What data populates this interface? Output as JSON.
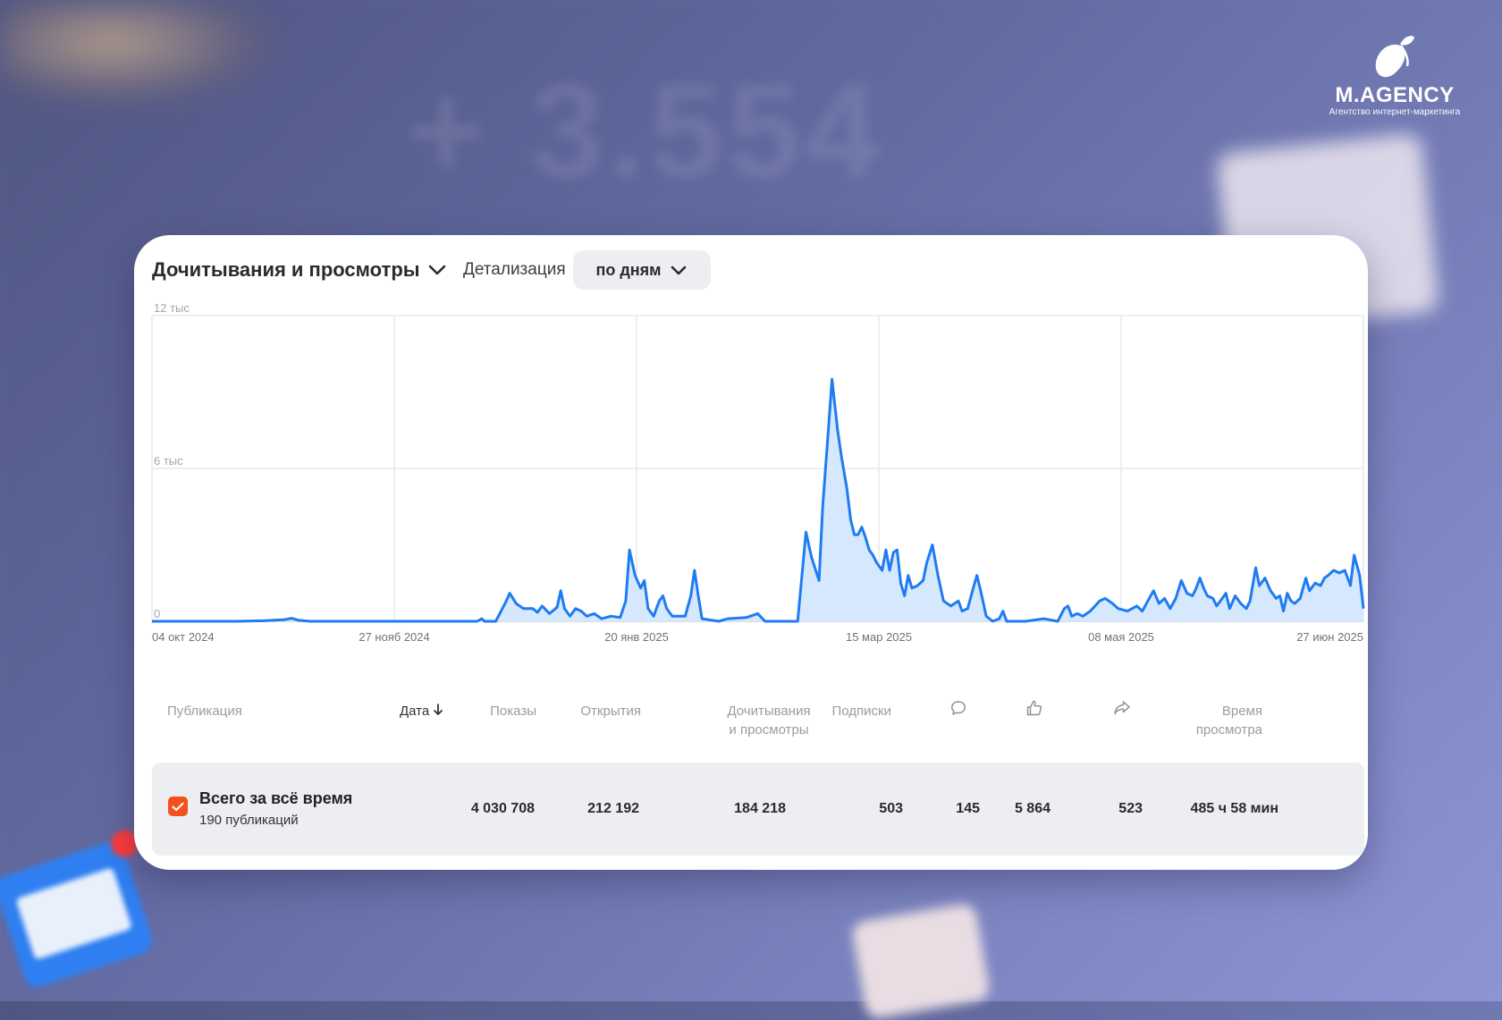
{
  "background": {
    "big_number": "+ 3.554"
  },
  "logo": {
    "name": "M.AGENCY",
    "tagline": "Агентство интернет-маркетинга"
  },
  "header": {
    "metric_select_label": "Дочитывания и просмотры",
    "detail_label": "Детализация",
    "period_select_label": "по дням"
  },
  "chart_data": {
    "type": "area",
    "y_tick_labels": [
      "12 тыс",
      "6 тыс",
      "0"
    ],
    "x_tick_labels": [
      "04 окт 2024",
      "27 нояб 2024",
      "20 янв 2025",
      "15 мар 2025",
      "08 мая 2025",
      "27 июн 2025"
    ],
    "ylim": [
      0,
      12000
    ],
    "grid": true,
    "color": "#1f7cf0",
    "fill_color": "#d6e8fd",
    "series": [
      {
        "points": [
          [
            0,
            0
          ],
          [
            30,
            0
          ],
          [
            60,
            0
          ],
          [
            90,
            0
          ],
          [
            120,
            20
          ],
          [
            142,
            60
          ],
          [
            150,
            120
          ],
          [
            158,
            40
          ],
          [
            170,
            0
          ],
          [
            200,
            0
          ],
          [
            230,
            0
          ],
          [
            260,
            0
          ],
          [
            290,
            0
          ],
          [
            320,
            0
          ],
          [
            350,
            0
          ],
          [
            355,
            100
          ],
          [
            358,
            0
          ],
          [
            370,
            0
          ],
          [
            380,
            700
          ],
          [
            385,
            1100
          ],
          [
            392,
            700
          ],
          [
            400,
            500
          ],
          [
            410,
            500
          ],
          [
            415,
            350
          ],
          [
            420,
            600
          ],
          [
            428,
            300
          ],
          [
            436,
            550
          ],
          [
            440,
            1200
          ],
          [
            444,
            500
          ],
          [
            450,
            200
          ],
          [
            456,
            500
          ],
          [
            462,
            400
          ],
          [
            468,
            200
          ],
          [
            476,
            300
          ],
          [
            484,
            100
          ],
          [
            494,
            200
          ],
          [
            504,
            150
          ],
          [
            510,
            800
          ],
          [
            514,
            2800
          ],
          [
            520,
            1800
          ],
          [
            526,
            1300
          ],
          [
            530,
            1600
          ],
          [
            534,
            500
          ],
          [
            540,
            200
          ],
          [
            546,
            800
          ],
          [
            550,
            1000
          ],
          [
            554,
            500
          ],
          [
            560,
            200
          ],
          [
            574,
            200
          ],
          [
            580,
            1000
          ],
          [
            584,
            2000
          ],
          [
            588,
            1000
          ],
          [
            592,
            100
          ],
          [
            610,
            0
          ],
          [
            620,
            100
          ],
          [
            640,
            150
          ],
          [
            652,
            300
          ],
          [
            660,
            0
          ],
          [
            680,
            0
          ],
          [
            695,
            0
          ],
          [
            704,
            3500
          ],
          [
            710,
            2500
          ],
          [
            718,
            1600
          ],
          [
            722,
            4500
          ],
          [
            728,
            7500
          ],
          [
            732,
            9500
          ],
          [
            738,
            7500
          ],
          [
            742,
            6500
          ],
          [
            748,
            5200
          ],
          [
            752,
            4000
          ],
          [
            756,
            3400
          ],
          [
            760,
            3400
          ],
          [
            764,
            3700
          ],
          [
            768,
            3300
          ],
          [
            772,
            2800
          ],
          [
            776,
            2600
          ],
          [
            780,
            2300
          ],
          [
            786,
            2000
          ],
          [
            790,
            2800
          ],
          [
            794,
            2000
          ],
          [
            798,
            2700
          ],
          [
            802,
            2800
          ],
          [
            806,
            1500
          ],
          [
            810,
            1000
          ],
          [
            814,
            1800
          ],
          [
            818,
            1300
          ],
          [
            824,
            1400
          ],
          [
            830,
            1600
          ],
          [
            834,
            2300
          ],
          [
            840,
            3000
          ],
          [
            846,
            1800
          ],
          [
            852,
            800
          ],
          [
            860,
            600
          ],
          [
            868,
            800
          ],
          [
            872,
            400
          ],
          [
            878,
            500
          ],
          [
            884,
            1300
          ],
          [
            888,
            1800
          ],
          [
            892,
            1200
          ],
          [
            898,
            200
          ],
          [
            905,
            0
          ],
          [
            912,
            100
          ],
          [
            916,
            400
          ],
          [
            920,
            0
          ],
          [
            940,
            0
          ],
          [
            960,
            100
          ],
          [
            975,
            0
          ],
          [
            982,
            500
          ],
          [
            986,
            600
          ],
          [
            990,
            200
          ],
          [
            996,
            300
          ],
          [
            1002,
            200
          ],
          [
            1010,
            400
          ],
          [
            1020,
            800
          ],
          [
            1026,
            900
          ],
          [
            1034,
            700
          ],
          [
            1040,
            500
          ],
          [
            1050,
            400
          ],
          [
            1060,
            600
          ],
          [
            1066,
            400
          ],
          [
            1072,
            800
          ],
          [
            1078,
            1200
          ],
          [
            1084,
            700
          ],
          [
            1090,
            900
          ],
          [
            1096,
            500
          ],
          [
            1102,
            900
          ],
          [
            1108,
            1600
          ],
          [
            1114,
            1100
          ],
          [
            1120,
            1000
          ],
          [
            1124,
            1300
          ],
          [
            1128,
            1700
          ],
          [
            1132,
            1300
          ],
          [
            1136,
            1000
          ],
          [
            1142,
            900
          ],
          [
            1146,
            600
          ],
          [
            1152,
            900
          ],
          [
            1156,
            1100
          ],
          [
            1160,
            500
          ],
          [
            1166,
            1000
          ],
          [
            1172,
            700
          ],
          [
            1178,
            500
          ],
          [
            1182,
            800
          ],
          [
            1188,
            2100
          ],
          [
            1192,
            1400
          ],
          [
            1198,
            1700
          ],
          [
            1204,
            1200
          ],
          [
            1210,
            900
          ],
          [
            1214,
            1000
          ],
          [
            1218,
            400
          ],
          [
            1222,
            1100
          ],
          [
            1226,
            800
          ],
          [
            1230,
            700
          ],
          [
            1236,
            900
          ],
          [
            1242,
            1700
          ],
          [
            1246,
            1200
          ],
          [
            1252,
            1500
          ],
          [
            1258,
            1400
          ],
          [
            1262,
            1700
          ],
          [
            1266,
            1800
          ],
          [
            1272,
            2000
          ],
          [
            1278,
            1900
          ],
          [
            1284,
            2000
          ],
          [
            1290,
            1400
          ],
          [
            1294,
            2600
          ],
          [
            1300,
            1800
          ],
          [
            1304,
            500
          ]
        ]
      }
    ]
  },
  "table": {
    "columns": {
      "publication": "Публикация",
      "date": "Дата",
      "impressions": "Показы",
      "opens": "Открытия",
      "reads_line1": "Дочитывания",
      "reads_line2": "и просмотры",
      "subscriptions": "Подписки",
      "watch_time_line1": "Время",
      "watch_time_line2": "просмотра"
    },
    "total_row": {
      "title": "Всего за всё время",
      "subtitle": "190 публикаций",
      "impressions": "4 030 708",
      "opens": "212 192",
      "reads": "184 218",
      "subscriptions": "503",
      "comments": "145",
      "likes": "5 864",
      "shares": "523",
      "watch_time": "485 ч 58 мин"
    }
  }
}
